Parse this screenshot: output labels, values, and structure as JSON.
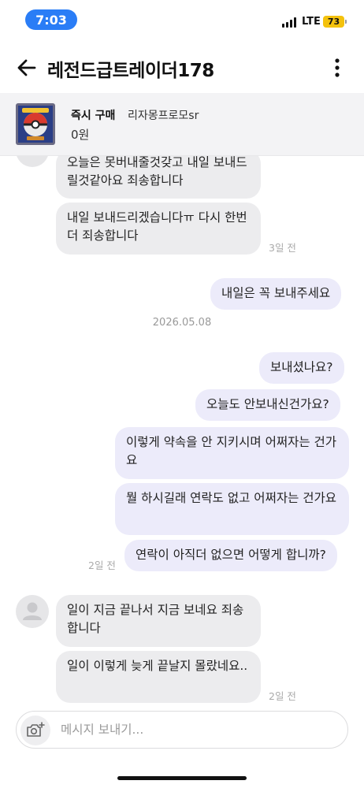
{
  "status_bar": {
    "time": "7:03",
    "network": "LTE",
    "battery": "73"
  },
  "header": {
    "title": "레전드급트레이더178",
    "back_icon": "arrow-left-icon",
    "more_icon": "vertical-dots-icon"
  },
  "product": {
    "type": "즉시 구매",
    "name": "리자몽프로모sr",
    "price": "0원",
    "thumb_icon": "pokemon-card-image"
  },
  "messages": {
    "m1": "오늘은 못버내줄것갖고 내일 보내드릴것같아요 죄송합니다",
    "m2": "내일 보내드리겠습니다ㅠ 다시 한번 더 죄송합니다",
    "m2_time": "3일 전",
    "m3": "내일은 꼭 보내주세요",
    "date_separator": "2026.05.08",
    "m4": "보내셨나요?",
    "m5": "오늘도 안보내신건가요?",
    "m6": "이렇게 약속을 안 지키시며 어쩌자는 건가요",
    "m7": "뭘 하시길래 연락도 없고 어쩌자는 건가요",
    "m8": "연락이 아직더 없으면 어떻게 합니까?",
    "m8_time": "2일 전",
    "m9": "일이 지금 끝나서 지금 보네요 죄송합니다",
    "m10": "일이 이렇게 늦게 끝날지 몰랐네요..",
    "m10_time": "2일 전"
  },
  "composer": {
    "placeholder": "메시지 보내기...",
    "value": "",
    "camera_icon": "camera-plus-icon"
  },
  "colors": {
    "time_pill": "#2a7df6",
    "battery": "#f4c20d",
    "incoming_bubble": "#ececee",
    "outgoing_bubble": "#ecebfa"
  }
}
